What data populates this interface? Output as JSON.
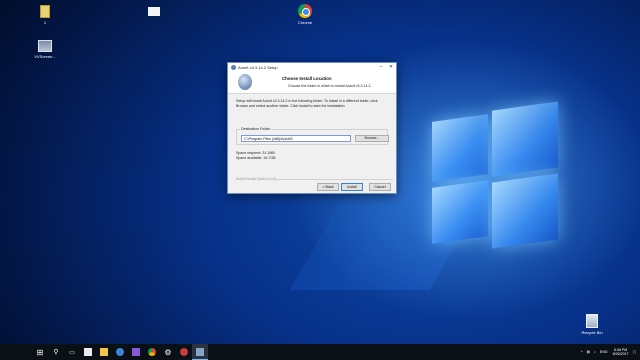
{
  "desktop": {
    "icons": [
      {
        "label": "1"
      },
      {
        "label": ""
      },
      {
        "label": "Chrome"
      },
      {
        "label": "VVScreen..."
      },
      {
        "label": "Recycle Bin"
      }
    ]
  },
  "dialog": {
    "window_title": "AutoIt v3.3.14.2 Setup",
    "header_title": "Choose Install Location",
    "header_subtitle": "Choose the folder in which to install AutoIt v3.3.14.2.",
    "intro": "Setup will install AutoIt v3.3.14.2 in the following folder. To install in a different folder, click Browse and select another folder. Click Install to start the installation.",
    "destination_label": "Destination Folder",
    "destination_value": "C:\\Program Files (x86)\\AutoIt3",
    "browse_label": "Browse...",
    "space_required": "Space required: 31.1MB",
    "space_available": "Space available: 16.7GB",
    "brand_line": "Nullsoft Install System v2.46",
    "back_label": "< Back",
    "install_label": "Install",
    "cancel_label": "Cancel"
  },
  "taskbar": {
    "tray": {
      "language": "ENG",
      "time": "8:38 PM",
      "date": "8/26/2017"
    }
  }
}
